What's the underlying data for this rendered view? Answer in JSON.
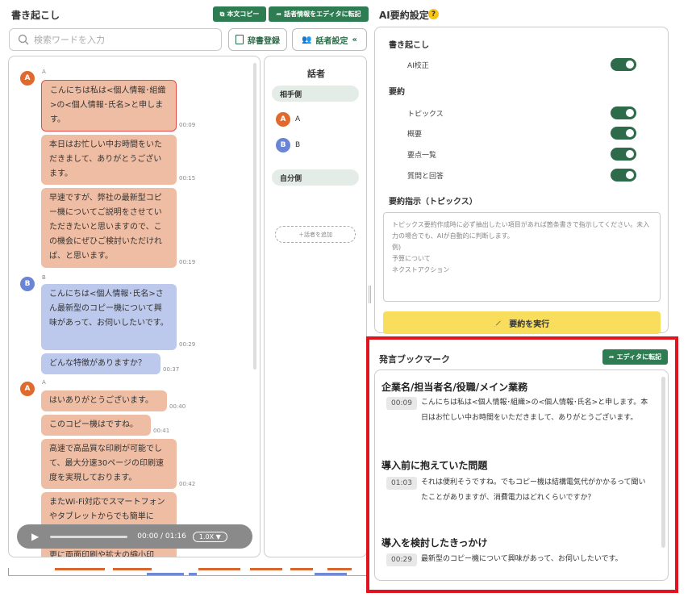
{
  "left": {
    "title": "書き起こし",
    "copy_btn": "本文コピー",
    "transfer_btn": "話者情報をエディタに転記",
    "search_placeholder": "検索ワードを入力",
    "dict_btn": "辞書登録",
    "speaker_btn": "話者設定"
  },
  "chat": {
    "groups": [
      {
        "speaker": "A",
        "messages": [
          {
            "text": "こんにちは私は<個人情報･組織>の<個人情報･氏名>と申します。",
            "time": "00:09"
          },
          {
            "text": "本日はお忙しい中お時間をいただきまして、ありがとうございます。",
            "time": "00:15"
          },
          {
            "text": "早速ですが、弊社の最新型コピー機についてご説明をさせていただきたいと思いますので、この機会にぜひご検討いただければ、と思います。",
            "time": "00:19"
          }
        ]
      },
      {
        "speaker": "B",
        "messages": [
          {
            "text": "こんにちは<個人情報･氏名>さん最新型のコピー機について興味があって、お伺いしたいです。",
            "time": "00:29"
          },
          {
            "text": "どんな特徴がありますか？",
            "time": "00:37"
          }
        ]
      },
      {
        "speaker": "A",
        "messages": [
          {
            "text": "はいありがとうございます。",
            "time": "00:40"
          },
          {
            "text": "このコピー機はですね。",
            "time": "00:41"
          },
          {
            "text": "高速で高品質な印刷が可能でして、最大分速30ページの印刷速度を実現しております。",
            "time": "00:42"
          },
          {
            "text": "またWi‐Fi対応でスマートフォンやタブレットからでも簡単に",
            "time": ""
          },
          {
            "text": "更に両面印刷や拡大の縮小印",
            "time": ""
          }
        ]
      }
    ]
  },
  "player": {
    "time": "00:00 / 01:16",
    "speed": "1.0X ▼"
  },
  "speakers": {
    "title": "話者",
    "other_group": "相手側",
    "self_group": "自分側",
    "list": [
      {
        "initial": "A",
        "name": "A"
      },
      {
        "initial": "B",
        "name": "B"
      }
    ],
    "add": "＋話者を追加"
  },
  "ai": {
    "title": "AI要約設定",
    "help": "?",
    "transcription": "書き起こし",
    "ai_correct": "AI校正",
    "summary": "要約",
    "options": [
      "トピックス",
      "概要",
      "要点一覧",
      "質問と回答"
    ],
    "instruction_title": "要約指示（トピックス）",
    "instruction_placeholder": "トピックス要約作成時に必ず抽出したい項目があれば箇条書きで指示してください。未入力の場合でも、AIが自動的に判断します。\n例)\n予算について\nネクストアクション",
    "execute": "要約を実行"
  },
  "bookmarks": {
    "title": "発言ブックマーク",
    "transfer": "エディタに転記",
    "items": [
      {
        "heading": "企業名/担当者名/役職/メイン業務",
        "time": "00:09",
        "text": "こんにちは私は<個人情報･組織>の<個人情報･氏名>と申します。本日はお忙しい中お時間をいただきまして、ありがとうございます。"
      },
      {
        "heading": "導入前に抱えていた問題",
        "time": "01:03",
        "text": "それは便利そうですね。でもコピー機は結構電気代がかかるって聞いたことがありますが、消費電力はどれくらいですか？"
      },
      {
        "heading": "導入を検討したきっかけ",
        "time": "00:29",
        "text": "最新型のコピー機について興味があって、お伺いしたいです。"
      }
    ]
  },
  "colors": {
    "green": "#2e7d52",
    "speaker_a": "#e06a2e",
    "speaker_b": "#6a85d6",
    "highlight": "#e0141e",
    "execute": "#f9dd5c"
  },
  "toggles": {
    "ai_correct": true,
    "トピックス": true,
    "概要": true,
    "要点一覧": true,
    "質問と回答": true
  }
}
